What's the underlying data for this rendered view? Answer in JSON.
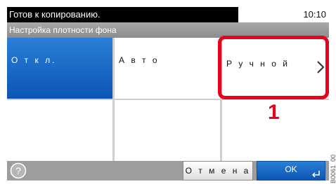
{
  "status": {
    "message": "Готов к копированию.",
    "time": "10:10"
  },
  "screen": {
    "title": "Настройка плотности фона"
  },
  "options": [
    {
      "label": "О т к л.",
      "selected": true
    },
    {
      "label": "А в т о",
      "selected": false
    },
    {
      "label": "Р у ч н о й",
      "selected": false,
      "has_submenu": true
    }
  ],
  "annotation": {
    "callout_number": "1"
  },
  "buttons": {
    "cancel_label": "О т м е н а",
    "ok_label": "OK"
  },
  "figure_code": "B0061_00",
  "colors": {
    "selected": "#1a6ac8",
    "highlight": "#e8001d",
    "status_bar": "#000000"
  },
  "icons": {
    "help": "question-circle-icon",
    "submenu": "chevron-right-icon",
    "enter": "enter-return-icon"
  }
}
